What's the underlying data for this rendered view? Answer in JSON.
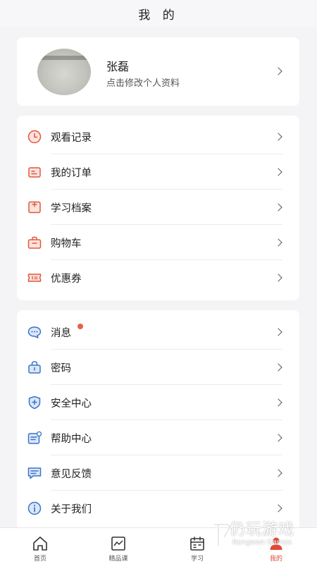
{
  "header": {
    "title": "我 的"
  },
  "profile": {
    "name": "张磊",
    "subtitle": "点击修改个人资料"
  },
  "menu_group_1": [
    {
      "label": "观看记录",
      "icon": "clock-icon"
    },
    {
      "label": "我的订单",
      "icon": "order-icon"
    },
    {
      "label": "学习档案",
      "icon": "archive-icon"
    },
    {
      "label": "购物车",
      "icon": "cart-bag-icon"
    },
    {
      "label": "优惠券",
      "icon": "coupon-icon"
    }
  ],
  "menu_group_2": [
    {
      "label": "消息",
      "icon": "chat-bubble-icon",
      "has_badge": true
    },
    {
      "label": "密码",
      "icon": "lock-icon"
    },
    {
      "label": "安全中心",
      "icon": "shield-icon"
    },
    {
      "label": "帮助中心",
      "icon": "help-icon"
    },
    {
      "label": "意见反馈",
      "icon": "feedback-icon"
    },
    {
      "label": "关于我们",
      "icon": "info-icon"
    }
  ],
  "tabbar": [
    {
      "label": "首页",
      "icon": "home-icon"
    },
    {
      "label": "精品课",
      "icon": "course-icon"
    },
    {
      "label": "学习",
      "icon": "calendar-icon"
    },
    {
      "label": "我的",
      "icon": "user-icon",
      "active": true
    }
  ],
  "colors": {
    "accent": "#e24a36",
    "menu_icon_red": "#e2573f",
    "menu_icon_blue": "#3b73c9",
    "badge": "#e8604c"
  },
  "watermark": {
    "text": "仍玩游戏",
    "sub": "Rengwan Games"
  }
}
